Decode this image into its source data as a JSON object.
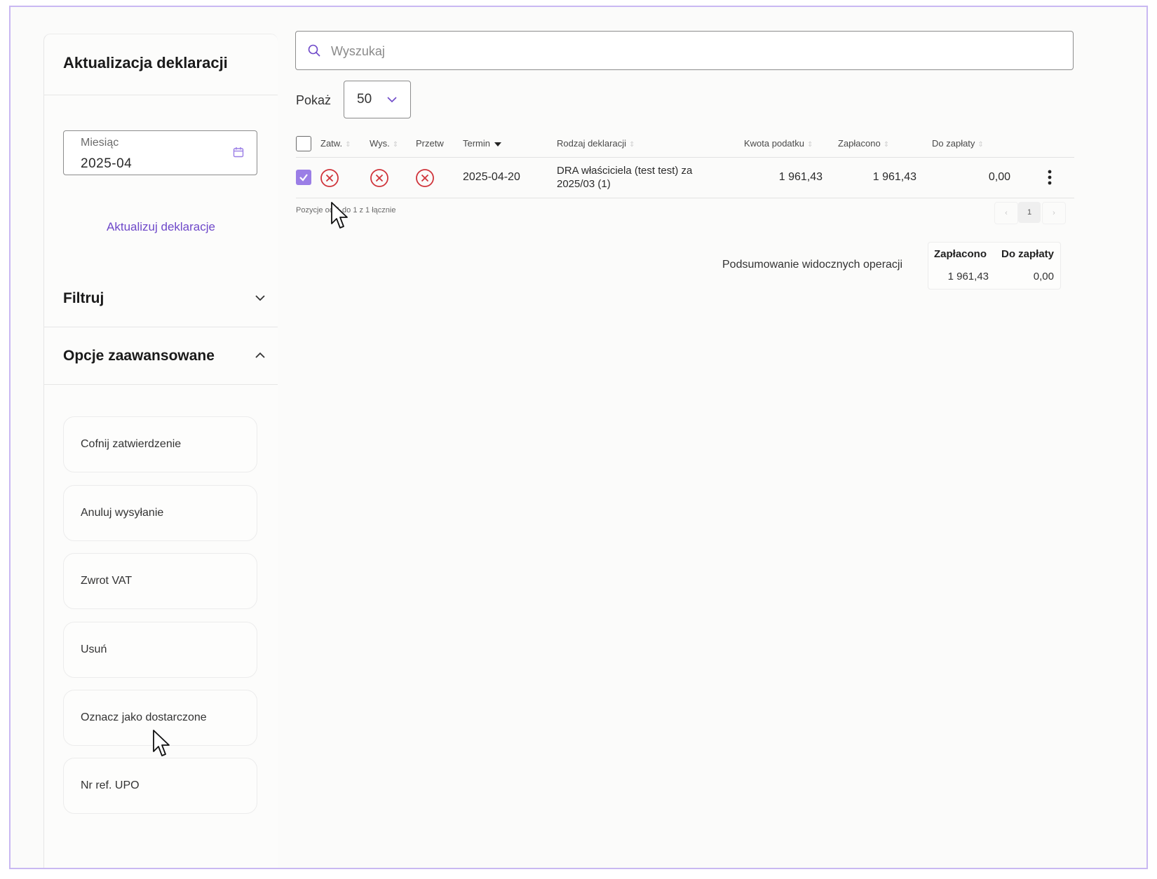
{
  "sidebar": {
    "title": "Aktualizacja deklaracji",
    "month_field": {
      "label": "Miesiąc",
      "value": "2025-04"
    },
    "update_link": "Aktualizuj deklaracje",
    "filter_label": "Filtruj",
    "advanced_label": "Opcje zaawansowane",
    "options": [
      "Cofnij zatwierdzenie",
      "Anuluj wysyłanie",
      "Zwrot VAT",
      "Usuń",
      "Oznacz jako dostarczone",
      "Nr ref. UPO"
    ]
  },
  "search": {
    "placeholder": "Wyszukaj"
  },
  "show": {
    "label": "Pokaż",
    "value": "50"
  },
  "table": {
    "headers": {
      "approved": "Zatw.",
      "sent": "Wys.",
      "processed": "Przetw",
      "deadline": "Termin",
      "type": "Rodzaj deklaracji",
      "tax_amount": "Kwota podatku",
      "paid": "Zapłacono",
      "due": "Do zapłaty"
    },
    "rows": [
      {
        "checked": true,
        "deadline": "2025-04-20",
        "type_line1": "DRA właściciela (test test) za",
        "type_line2": "2025/03 (1)",
        "tax_amount": "1 961,43",
        "paid": "1 961,43",
        "due": "0,00"
      }
    ]
  },
  "pagination": {
    "info": "Pozycje od 1 do 1 z 1 łącznie",
    "prev": "‹",
    "page": "1",
    "next": "›"
  },
  "summary": {
    "label": "Podsumowanie widocznych operacji",
    "paid_header": "Zapłacono",
    "due_header": "Do zapłaty",
    "paid_value": "1 961,43",
    "due_value": "0,00"
  },
  "colors": {
    "accent": "#9b7ee6",
    "link": "#6e48c9",
    "error": "#d0343b",
    "frame": "#c9b8f2"
  }
}
